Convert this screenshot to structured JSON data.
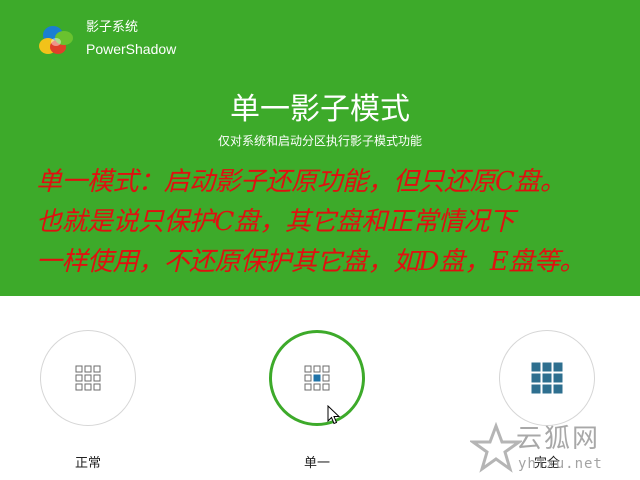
{
  "brand": {
    "name_cn": "影子系统",
    "name_en": "PowerShadow"
  },
  "mode": {
    "title": "单一影子模式",
    "subtitle": "仅对系统和启动分区执行影子模式功能"
  },
  "note": {
    "lines": [
      "单一模式：启动影子还原功能，但只还原C盘。",
      "也就是说只保护C盘，其它盘和正常情况下",
      "一样使用，不还原保护其它盘，如D盘，E盘等。"
    ],
    "color": "#e01010"
  },
  "options": [
    {
      "label": "正常",
      "selected": false
    },
    {
      "label": "单一",
      "selected": true
    },
    {
      "label": "完全",
      "selected": false
    }
  ],
  "colors": {
    "header": "#3daa2a",
    "selected_ring": "#3daa2a",
    "icon_fill": "#2e6f8f"
  },
  "watermark": {
    "text_cn": "云狐网",
    "url": "yhfxu.net"
  }
}
